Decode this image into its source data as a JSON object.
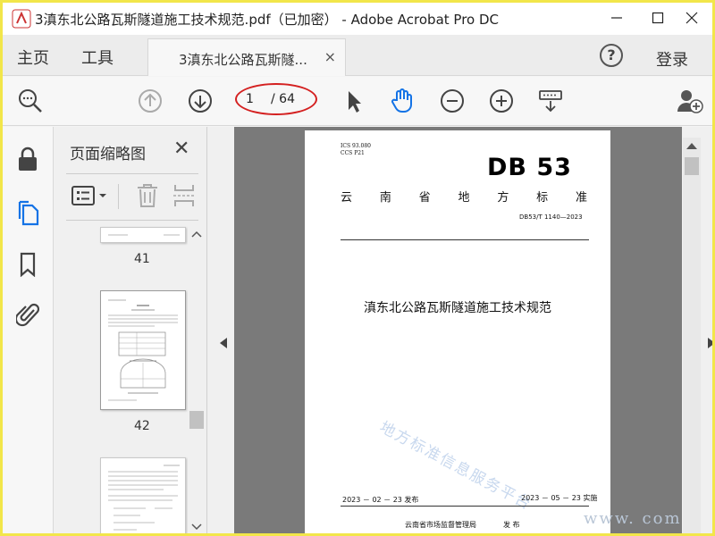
{
  "window": {
    "title": "3滇东北公路瓦斯隧道施工技术规范.pdf（已加密） - Adobe Acrobat Pro DC",
    "minimize_icon": "minimize-icon",
    "maximize_icon": "maximize-icon",
    "close_icon": "close-icon"
  },
  "tabs": {
    "home": "主页",
    "tools": "工具",
    "document": "3滇东北公路瓦斯隧...",
    "document_close": "×",
    "help": "?",
    "login": "登录"
  },
  "toolbar": {
    "current_page": "1",
    "total_pages": "/ 64",
    "icons": [
      "zoom-search-icon",
      "page-up-icon",
      "page-down-icon",
      "select-arrow-icon",
      "hand-tool-icon",
      "zoom-out-icon",
      "zoom-in-icon",
      "keyboard-icon",
      "add-user-icon"
    ]
  },
  "rail": {
    "icons": [
      "lock-icon",
      "pages-icon",
      "bookmark-icon",
      "attachment-icon"
    ]
  },
  "thumbnails": {
    "title": "页面缩略图",
    "close": "✕",
    "pages": [
      {
        "label": "41"
      },
      {
        "label": "42"
      }
    ]
  },
  "document": {
    "ics": "ICS  93.080",
    "ccs": "CCS  P21",
    "db": "DB 53",
    "standard_chars": [
      "云",
      "南",
      "省",
      "地",
      "方",
      "标",
      "准"
    ],
    "code": "DB53/T  1140—2023",
    "title": "滇东北公路瓦斯隧道施工技术规范",
    "watermark": "地方标准信息服务平台",
    "issue_date": "2023 － 02 － 23 发布",
    "effective_date": "2023 － 05 － 23 实施",
    "publisher": "云南省市场监督管理局",
    "publish": "发  布",
    "corner_watermark": "www.        com"
  },
  "colors": {
    "accent_blue": "#1473e6",
    "highlight_ring": "#d42020",
    "frame_border": "#f2e64a"
  }
}
